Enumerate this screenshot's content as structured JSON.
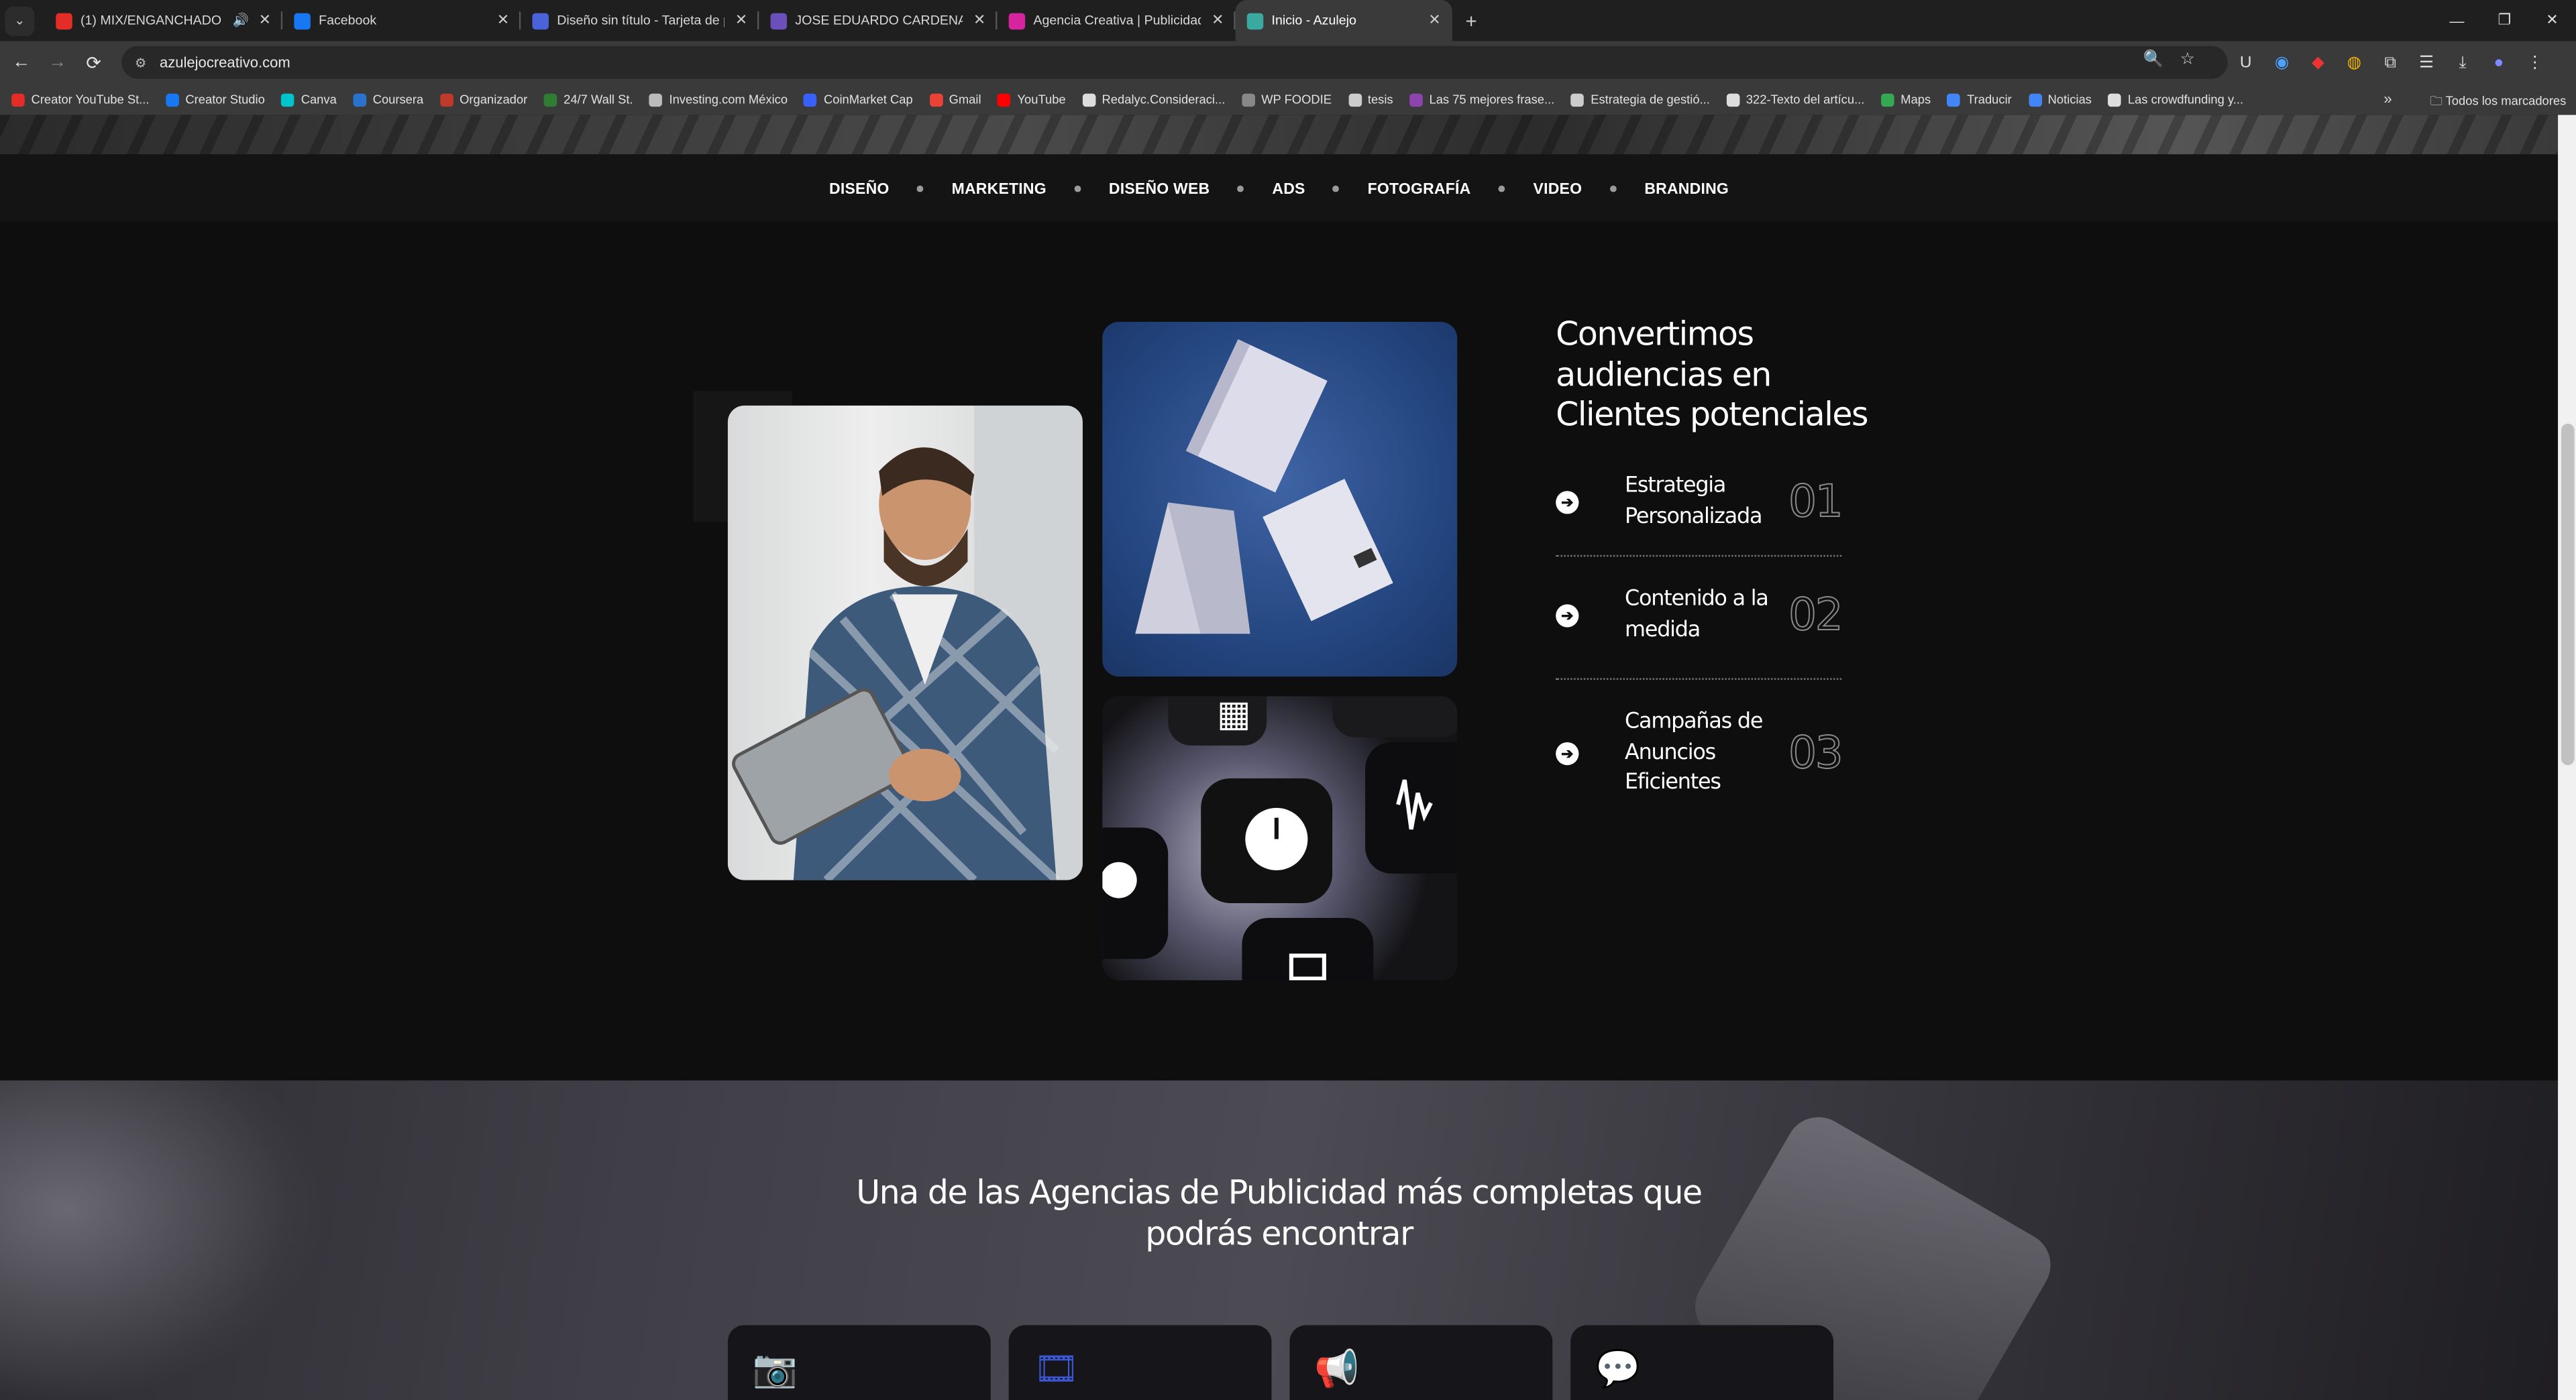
{
  "browser": {
    "tabs": [
      {
        "title": "(1) MIX/ENGANCHADO | D",
        "icon_color": "#e52d27",
        "audio": "🔊",
        "active": false
      },
      {
        "title": "Facebook",
        "icon_color": "#1877f2",
        "active": false
      },
      {
        "title": "Diseño sin título - Tarjeta de pr",
        "icon_color": "#4a63d8",
        "active": false
      },
      {
        "title": "JOSE EDUARDO CARDENAS CC",
        "icon_color": "#6b4fbb",
        "active": false
      },
      {
        "title": "Agencia Creativa | Publicidad | ",
        "icon_color": "#d6249f",
        "active": false
      },
      {
        "title": "Inicio - Azulejo",
        "icon_color": "#3aa9a0",
        "active": true
      }
    ],
    "new_tab": "+",
    "url": "azulejocreativo.com",
    "bookmarks": [
      {
        "label": "Creator YouTube St...",
        "color": "#e52d27"
      },
      {
        "label": "Creator Studio",
        "color": "#1877f2"
      },
      {
        "label": "Canva",
        "color": "#00c4cc"
      },
      {
        "label": "Coursera",
        "color": "#2a73cc"
      },
      {
        "label": "Organizador",
        "color": "#c0392b"
      },
      {
        "label": "24/7 Wall St.",
        "color": "#2e7d32"
      },
      {
        "label": "Investing.com México",
        "color": "#bbbbbb"
      },
      {
        "label": "CoinMarket Cap",
        "color": "#3861fb"
      },
      {
        "label": "Gmail",
        "color": "#ea4335"
      },
      {
        "label": "YouTube",
        "color": "#ff0000"
      },
      {
        "label": "Redalyc.Consideraci...",
        "color": "#dddddd"
      },
      {
        "label": "WP FOODIE",
        "color": "#888888"
      },
      {
        "label": "tesis",
        "color": "#cccccc"
      },
      {
        "label": "Las 75 mejores frase...",
        "color": "#8e44ad"
      },
      {
        "label": "Estrategia de gestió...",
        "color": "#cccccc"
      },
      {
        "label": "322-Texto del artícu...",
        "color": "#dddddd"
      },
      {
        "label": "Maps",
        "color": "#34a853"
      },
      {
        "label": "Traducir",
        "color": "#4285f4"
      },
      {
        "label": "Noticias",
        "color": "#4285f4"
      },
      {
        "label": "Las crowdfunding y...",
        "color": "#dddddd"
      }
    ],
    "bookmarks_more": "»",
    "all_bookmarks": "Todos los marcadores"
  },
  "nav": {
    "items": [
      "DISEÑO",
      "MARKETING",
      "DISEÑO WEB",
      "ADS",
      "FOTOGRAFÍA",
      "VIDEO",
      "BRANDING"
    ]
  },
  "claim": {
    "title": "Convertimos audiencias en Clientes potenciales"
  },
  "features": [
    {
      "label": "Estrategia Personalizada",
      "number": "01"
    },
    {
      "label": "Contenido a la medida",
      "number": "02"
    },
    {
      "label": "Campañas de Anuncios Eficientes",
      "number": "03"
    }
  ],
  "section2": {
    "headline_line1": "Una de las Agencias de Publicidad más completas que",
    "headline_line2": "podrás encontrar"
  },
  "cards": [
    {
      "icon": "camera-icon",
      "glyph": "📷"
    },
    {
      "icon": "video-icon",
      "glyph": "🎞"
    },
    {
      "icon": "megaphone-icon",
      "glyph": "📢"
    },
    {
      "icon": "chat-icon",
      "glyph": "💬"
    }
  ],
  "colors": {
    "accent": "#3b57d6",
    "page_bg": "#0e0e0f"
  }
}
